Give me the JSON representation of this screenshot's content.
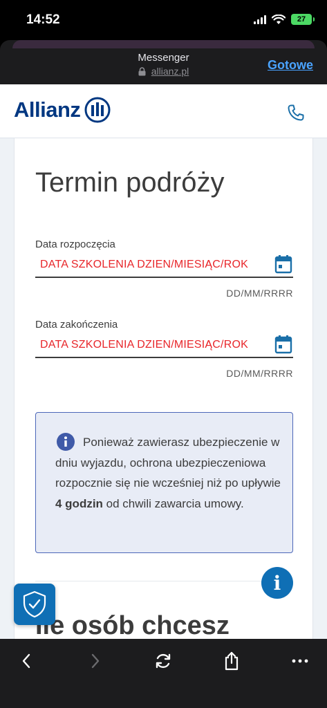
{
  "status_bar": {
    "time": "14:52",
    "battery": "27"
  },
  "browser": {
    "app_title": "Messenger",
    "url": "allianz.pl",
    "done_label": "Gotowe"
  },
  "site": {
    "brand": "Allianz"
  },
  "form": {
    "title": "Termin podróży",
    "start_date": {
      "label": "Data rozpoczęcia",
      "value": "DATA SZKOLENIA DZIEN/MIESIĄC/ROK",
      "hint": "DD/MM/RRRR"
    },
    "end_date": {
      "label": "Data zakończenia",
      "value": "DATA SZKOLENIA DZIEN/MIESIĄC/ROK",
      "hint": "DD/MM/RRRR"
    },
    "info": {
      "text_before": "Ponieważ zawierasz ubezpie­czenie w dniu wyjazdu, ochrona ubezpieczeniowa rozpocznie się nie wcześniej niż po upływie ",
      "text_bold": "4 godzin",
      "text_after": " od chwili zawarcia umowy."
    },
    "next_section_title": "Ile osób chcesz"
  },
  "colors": {
    "brand_blue": "#003781",
    "accent_blue": "#0f6fb5",
    "error_red": "#e8262a"
  },
  "icons": [
    "lock-icon",
    "phone-icon",
    "calendar-icon",
    "info-icon",
    "shield-check-icon",
    "back-icon",
    "forward-icon",
    "reload-icon",
    "share-icon",
    "more-icon"
  ]
}
